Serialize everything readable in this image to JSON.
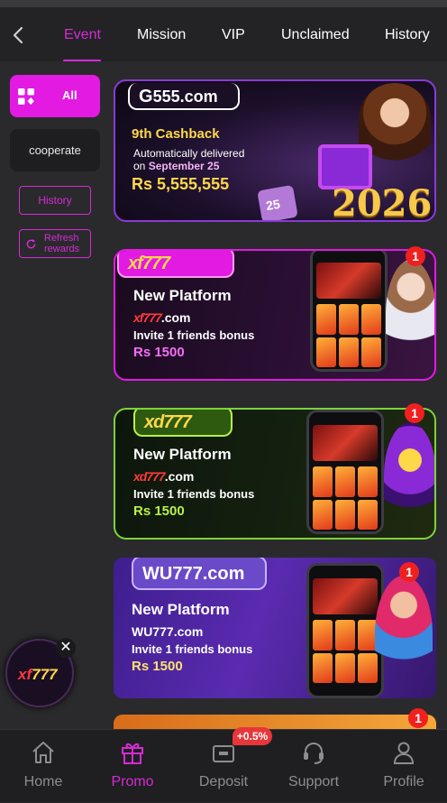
{
  "tabs": [
    {
      "label": "Event",
      "active": true
    },
    {
      "label": "Mission"
    },
    {
      "label": "VIP"
    },
    {
      "label": "Unclaimed"
    },
    {
      "label": "History"
    }
  ],
  "sidebar": {
    "all_label": "All",
    "cooperate_label": "cooperate",
    "history_label": "History",
    "refresh_label_1": "Refresh",
    "refresh_label_2": "rewards"
  },
  "banners": [
    {
      "brand": "555.com",
      "title": "9th Cashback",
      "line1": "Automatically delivered",
      "line2_prefix": "on",
      "line2_date": "September 25",
      "amount": "Rs  5,555,555",
      "calendar_day": "25",
      "year": "2026"
    },
    {
      "brand": "xf777",
      "headline": "New Platform",
      "domain_brand": "xf777",
      "domain_suffix": ".com",
      "invite": "Invite 1 friends bonus",
      "bonus": "Rs 1500",
      "badge": "1"
    },
    {
      "brand": "xd777",
      "headline": "New Platform",
      "domain_brand": "xd777",
      "domain_suffix": ".com",
      "invite": "Invite 1 friends bonus",
      "bonus": "Rs 1500",
      "badge": "1"
    },
    {
      "brand": "WU777.com",
      "headline": "New Platform",
      "domain_brand": "WU777",
      "domain_suffix": ".com",
      "invite": "Invite 1 friends bonus",
      "bonus": "Rs 1500",
      "badge": "1"
    },
    {
      "badge": "1"
    }
  ],
  "floating": {
    "logo_a": "xf",
    "logo_b": "777",
    "close": "✕"
  },
  "bottom_nav": [
    {
      "label": "Home",
      "icon": "home-icon"
    },
    {
      "label": "Promo",
      "icon": "gift-icon",
      "active": true
    },
    {
      "label": "Deposit",
      "icon": "wallet-icon"
    },
    {
      "label": "Support",
      "icon": "headset-icon"
    },
    {
      "label": "Profile",
      "icon": "user-icon"
    }
  ],
  "deposit_badge": "+0.5%",
  "colors": {
    "accent": "#d62ad6",
    "background": "#2a2a2c",
    "nav_inactive": "#8d8d92"
  }
}
